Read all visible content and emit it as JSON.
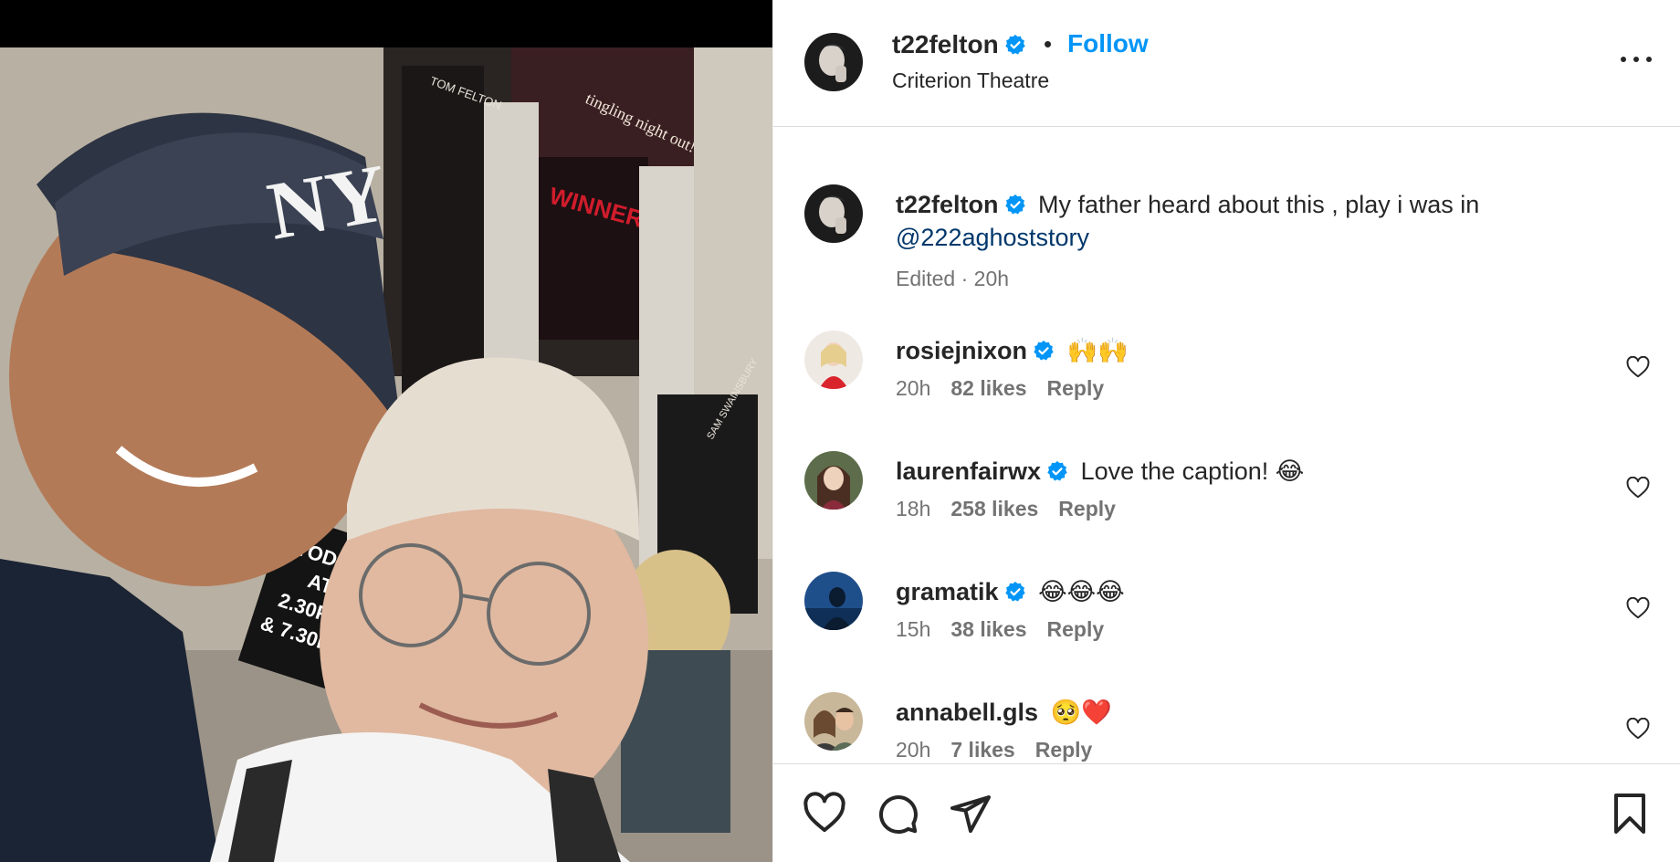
{
  "post": {
    "username": "t22felton",
    "follow_label": "Follow",
    "separator": "•",
    "location": "Criterion Theatre",
    "caption_text": "My father heard about this , play i was in",
    "caption_mention": "@222aghoststory",
    "caption_meta": "Edited · 20h"
  },
  "comments": [
    {
      "username": "rosiejnixon",
      "text": "🙌🙌",
      "time": "20h",
      "likes": "82 likes",
      "reply": "Reply"
    },
    {
      "username": "laurenfairwx",
      "text": "Love the caption! 😂",
      "time": "18h",
      "likes": "258 likes",
      "reply": "Reply"
    },
    {
      "username": "gramatik",
      "text": "😂😂😂",
      "time": "15h",
      "likes": "38 likes",
      "reply": "Reply"
    },
    {
      "username": "annabell.gls",
      "text": "🥺❤️",
      "time": "20h",
      "likes": "7 likes",
      "reply": "Reply"
    }
  ],
  "photo": {
    "poster_lines": [
      "TODAY",
      "AT",
      "2.30PM",
      "& 7.30PM"
    ],
    "banner_text": "tingling night out!",
    "winner_text": "WINNER!",
    "poster_name_1": "TOM FELTON",
    "poster_name_2": "SAM SWAINSBURY"
  },
  "colors": {
    "accent": "#0095f6",
    "verified": "#0095f6",
    "mention": "#00376b",
    "muted": "#737373"
  },
  "icons": {
    "like": "heart-outline-icon",
    "comment": "comment-bubble-icon",
    "share": "paper-plane-icon",
    "save": "bookmark-icon",
    "more": "ellipsis-icon",
    "verified": "verified-badge-icon"
  }
}
